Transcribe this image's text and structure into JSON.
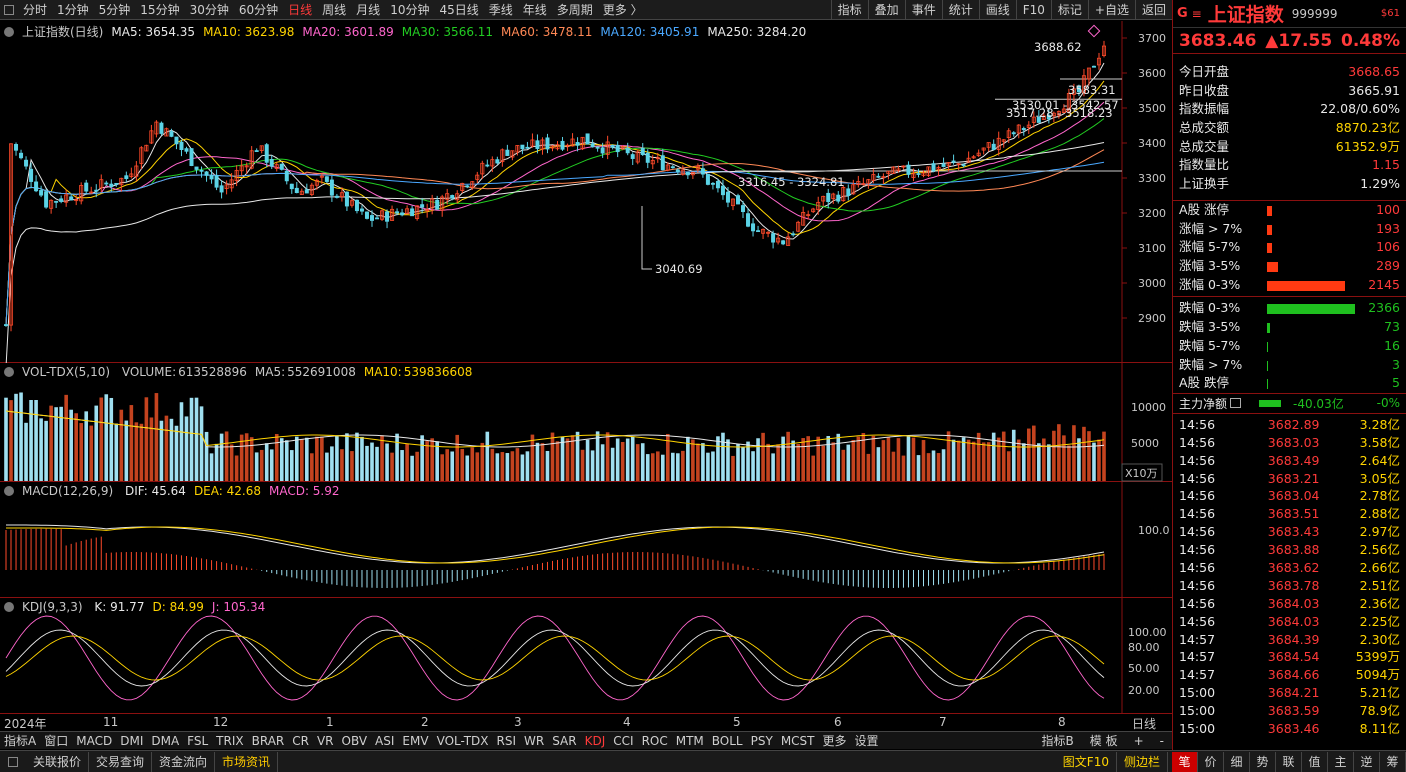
{
  "toolbar": {
    "periods": [
      "分时",
      "1分钟",
      "5分钟",
      "15分钟",
      "30分钟",
      "60分钟",
      "日线",
      "周线",
      "月线",
      "10分钟",
      "45日线",
      "季线",
      "年线",
      "多周期",
      "更多 〉"
    ],
    "active_period": "日线",
    "right_buttons": [
      "指标",
      "叠加",
      "事件",
      "统计",
      "画线",
      "F10",
      "标记",
      "+自选",
      "返回"
    ]
  },
  "main_panel": {
    "legend_title": "上证指数(日线)",
    "ma": [
      {
        "name": "MA5",
        "value": "3654.35",
        "color": "#e8e8e8"
      },
      {
        "name": "MA10",
        "value": "3623.98",
        "color": "#ffd400"
      },
      {
        "name": "MA20",
        "value": "3601.89",
        "color": "#ff66cc"
      },
      {
        "name": "MA30",
        "value": "3566.11",
        "color": "#22cc22"
      },
      {
        "name": "MA60",
        "value": "3478.11",
        "color": "#ff8855"
      },
      {
        "name": "MA120",
        "value": "3405.91",
        "color": "#4aa8ff"
      },
      {
        "name": "MA250",
        "value": "3284.20",
        "color": "#e8e8e8"
      }
    ],
    "yticks": [
      "3700",
      "3600",
      "3500",
      "3400",
      "3300",
      "3200",
      "3100",
      "3000",
      "2900"
    ],
    "annotations": {
      "high": "3688.62",
      "low": "3040.69",
      "a1": "3583.31",
      "a2": "3530.01 - 3542.57",
      "a3": "3517.28 - 3518.23",
      "a4": "3316.45 - 3324.81"
    }
  },
  "vol_panel": {
    "legend_title": "VOL-TDX(5,10)",
    "volume_label": "VOLUME:",
    "volume": "613528896",
    "ma5_label": "MA5:",
    "ma5": "552691008",
    "ma10_label": "MA10:",
    "ma10": "539836608",
    "yticks": [
      "10000",
      "5000"
    ],
    "unit": "X10万"
  },
  "macd_panel": {
    "legend_title": "MACD(12,26,9)",
    "dif": "DIF: 45.64",
    "dea": "DEA: 42.68",
    "macd": "MACD: 5.92",
    "yticks": [
      "100.0"
    ]
  },
  "kdj_panel": {
    "legend_title": "KDJ(9,3,3)",
    "k": "K: 91.77",
    "d": "D: 84.99",
    "j": "J: 105.34",
    "yticks": [
      "100.00",
      "80.00",
      "50.00",
      "20.00"
    ]
  },
  "time_axis": [
    "2024年",
    "11",
    "12",
    "1",
    "2",
    "3",
    "4",
    "5",
    "6",
    "7",
    "8",
    "日线"
  ],
  "indicators": [
    "指标A",
    "窗口",
    "MACD",
    "DMI",
    "DMA",
    "FSL",
    "TRIX",
    "BRAR",
    "CR",
    "VR",
    "OBV",
    "ASI",
    "EMV",
    "VOL-TDX",
    "RSI",
    "WR",
    "SAR",
    "KDJ",
    "CCI",
    "ROC",
    "MTM",
    "BOLL",
    "PSY",
    "MCST",
    "更多",
    "设置"
  ],
  "active_indicator": "KDJ",
  "ind_right": [
    "指标B",
    "模 板",
    "+",
    "-"
  ],
  "bottom": [
    "关联报价",
    "交易查询",
    "资金流向",
    "市场资讯"
  ],
  "bottom_active": "市场资讯",
  "bottom_right": [
    "图文F10",
    "侧边栏"
  ],
  "bottom_tabs": [
    "笔",
    "价",
    "细",
    "势",
    "联",
    "值",
    "主",
    "逆",
    "筹"
  ],
  "quote": {
    "logo": "G",
    "name": "上证指数",
    "code": "999999",
    "tag": "$61",
    "price": "3683.46",
    "change": "▲17.55",
    "pct": "0.48%",
    "stats": [
      {
        "label": "今日开盘",
        "value": "3668.65",
        "color": "red"
      },
      {
        "label": "昨日收盘",
        "value": "3665.91",
        "color": "white"
      },
      {
        "label": "指数振幅",
        "value": "22.08/0.60%",
        "color": "white"
      },
      {
        "label": "总成交额",
        "value": "8870.23亿",
        "color": "yellow"
      },
      {
        "label": "总成交量",
        "value": "61352.9万",
        "color": "yellow"
      },
      {
        "label": "指数量比",
        "value": "1.15",
        "color": "red"
      },
      {
        "label": "上证换手",
        "value": "1.29%",
        "color": "white"
      }
    ],
    "up": [
      {
        "label": "A股 涨停",
        "value": "100",
        "bar": 5
      },
      {
        "label": "涨幅 > 7%",
        "value": "193",
        "bar": 5
      },
      {
        "label": "涨幅 5-7%",
        "value": "106",
        "bar": 5
      },
      {
        "label": "涨幅 3-5%",
        "value": "289",
        "bar": 11
      },
      {
        "label": "涨幅 0-3%",
        "value": "2145",
        "bar": 78
      }
    ],
    "down": [
      {
        "label": "跌幅 0-3%",
        "value": "2366",
        "bar": 88
      },
      {
        "label": "跌幅 3-5%",
        "value": "73",
        "bar": 3
      },
      {
        "label": "跌幅 5-7%",
        "value": "16",
        "bar": 1
      },
      {
        "label": "跌幅 > 7%",
        "value": "3",
        "bar": 1
      },
      {
        "label": "A股 跌停",
        "value": "5",
        "bar": 1
      }
    ],
    "net_label": "主力净额",
    "net_value": "-40.03亿",
    "net_pct": "-0%",
    "ticks": [
      [
        "14:56",
        "3682.89",
        "3.28亿"
      ],
      [
        "14:56",
        "3683.03",
        "3.58亿"
      ],
      [
        "14:56",
        "3683.49",
        "2.64亿"
      ],
      [
        "14:56",
        "3683.21",
        "3.05亿"
      ],
      [
        "14:56",
        "3683.04",
        "2.78亿"
      ],
      [
        "14:56",
        "3683.51",
        "2.88亿"
      ],
      [
        "14:56",
        "3683.43",
        "2.97亿"
      ],
      [
        "14:56",
        "3683.88",
        "2.56亿"
      ],
      [
        "14:56",
        "3683.62",
        "2.66亿"
      ],
      [
        "14:56",
        "3683.78",
        "2.51亿"
      ],
      [
        "14:56",
        "3684.03",
        "2.36亿"
      ],
      [
        "14:56",
        "3684.03",
        "2.25亿"
      ],
      [
        "14:57",
        "3684.39",
        "2.30亿"
      ],
      [
        "14:57",
        "3684.54",
        "5399万"
      ],
      [
        "14:57",
        "3684.66",
        "5094万"
      ],
      [
        "15:00",
        "3684.21",
        "5.21亿"
      ],
      [
        "15:00",
        "3683.59",
        "78.9亿"
      ],
      [
        "15:00",
        "3683.46",
        "8.11亿"
      ]
    ]
  }
}
